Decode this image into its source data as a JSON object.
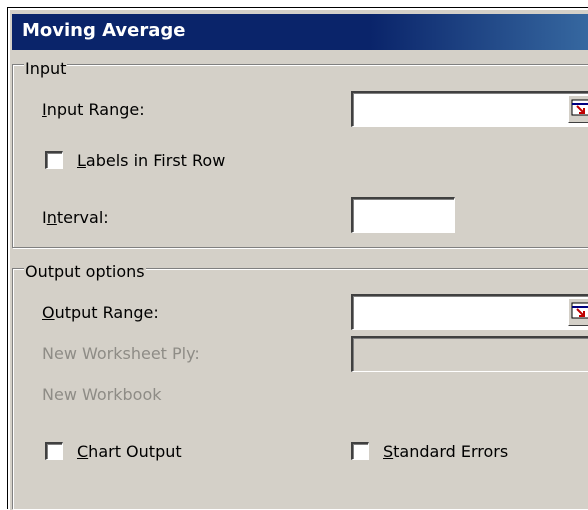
{
  "dialog": {
    "title": "Moving Average"
  },
  "input_group": {
    "legend": "Input",
    "input_range_label": "Input Range:",
    "input_range_value": "",
    "labels_first_row_label": "Labels in First Row",
    "labels_first_row_checked": false,
    "interval_label": "Interval:",
    "interval_value": ""
  },
  "output_group": {
    "legend": "Output options",
    "output_range_label": "Output Range:",
    "output_range_value": "",
    "new_worksheet_label": "New Worksheet Ply:",
    "new_worksheet_value": "",
    "new_workbook_label": "New Workbook",
    "chart_output_label": "Chart Output",
    "chart_output_checked": false,
    "standard_errors_label": "Standard Errors",
    "standard_errors_checked": false
  },
  "icons": {
    "range_selector": "collapse-dialog-icon"
  },
  "colors": {
    "titlebar": "#0a246a",
    "face": "#d4d0c8",
    "disabled_text": "#8e8c86"
  }
}
